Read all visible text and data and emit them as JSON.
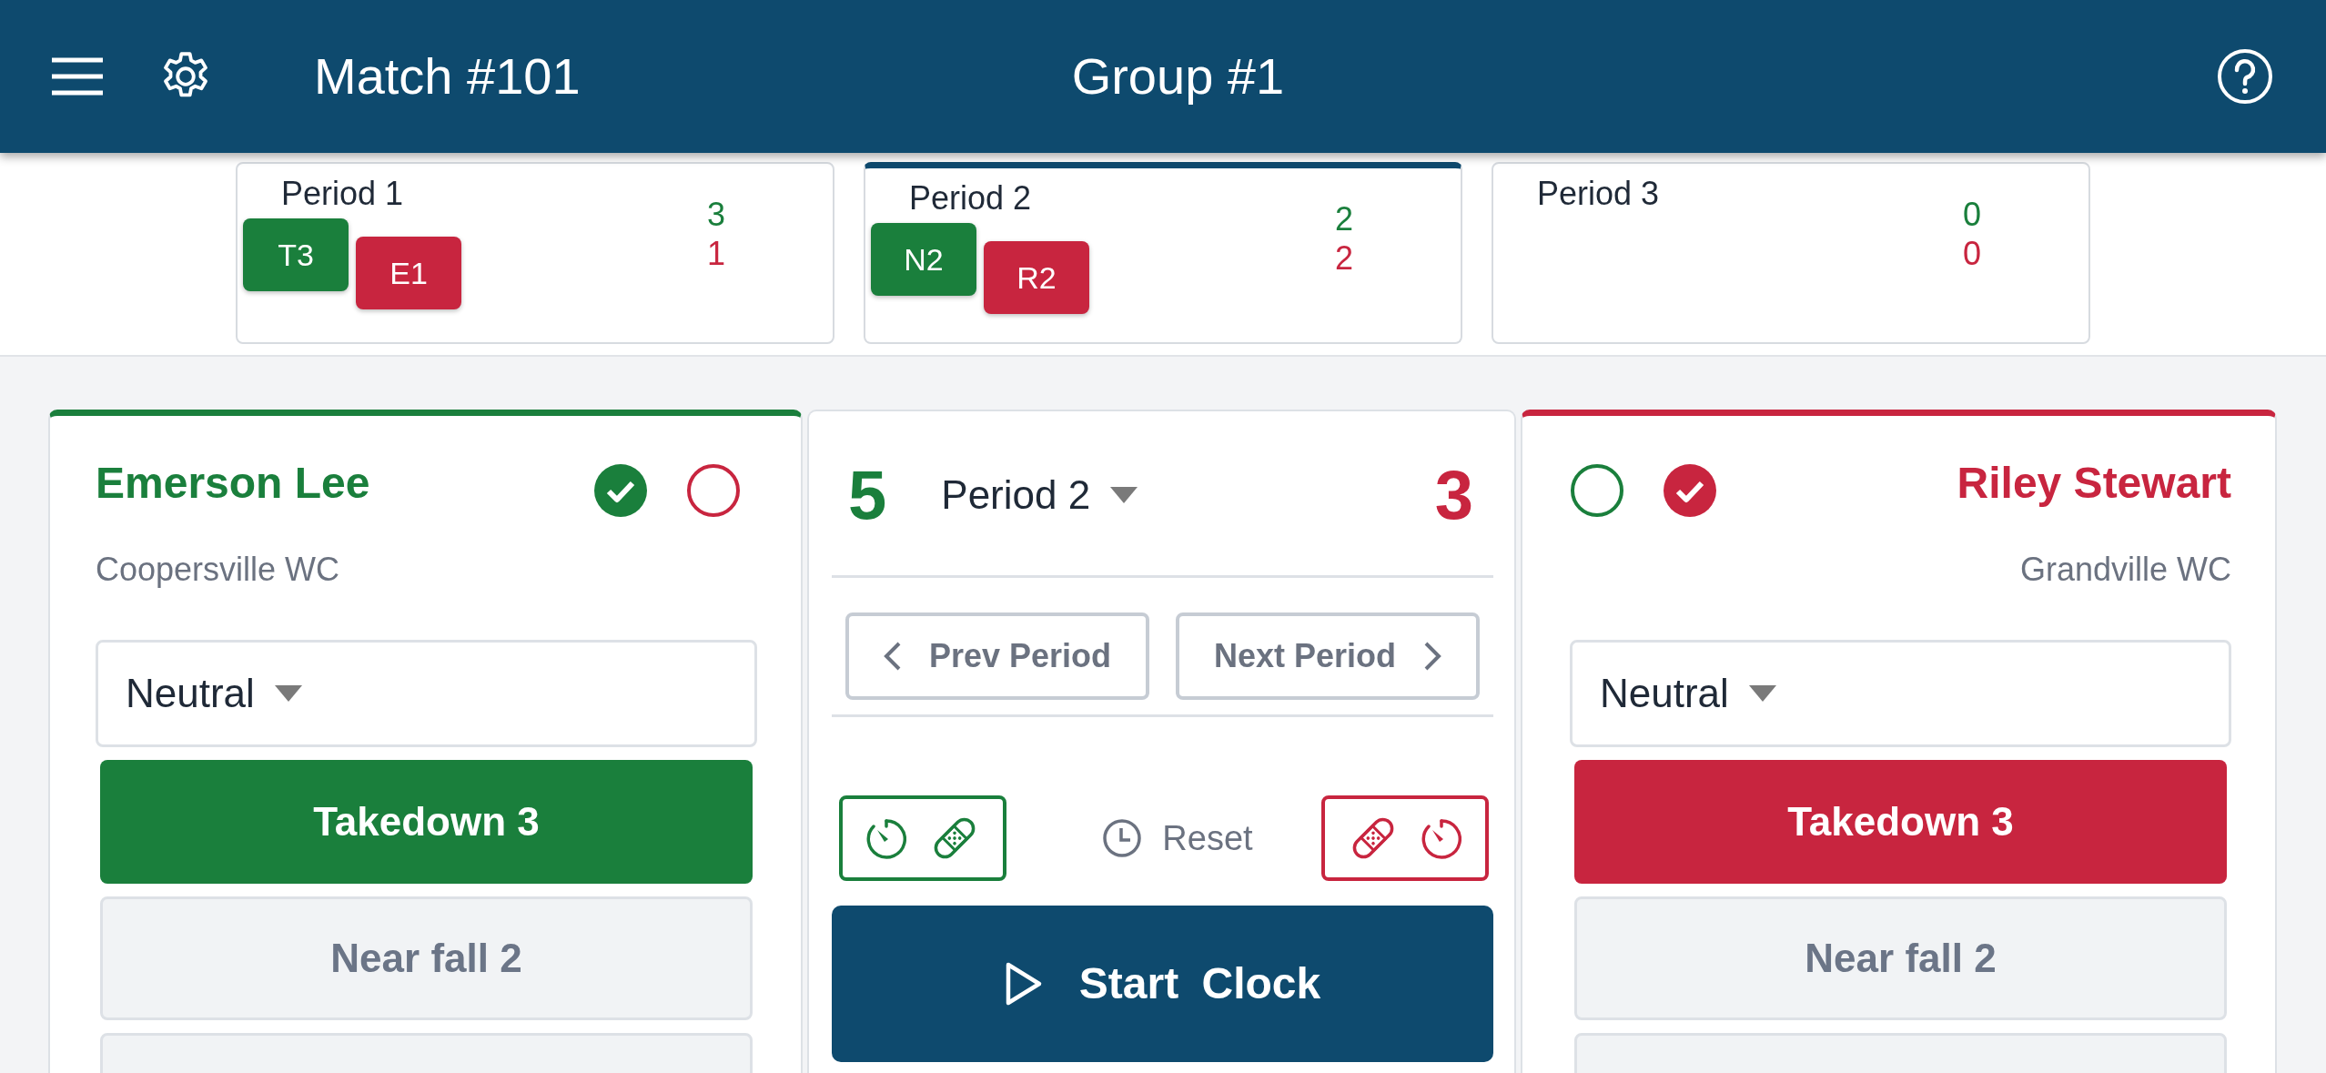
{
  "header": {
    "title": "Match #101",
    "subtitle": "Group #1"
  },
  "periods": [
    {
      "label": "Period 1",
      "selected": false,
      "chips": [
        {
          "text": "T3",
          "color": "#1a7f3c"
        },
        {
          "text": "E1",
          "color": "#c8253f"
        }
      ],
      "scores": [
        {
          "text": "3",
          "color": "#1a7f3c"
        },
        {
          "text": "1",
          "color": "#c8253f"
        }
      ]
    },
    {
      "label": "Period 2",
      "selected": true,
      "chips": [
        {
          "text": "N2",
          "color": "#1a7f3c"
        },
        {
          "text": "R2",
          "color": "#c8253f"
        }
      ],
      "scores": [
        {
          "text": "2",
          "color": "#1a7f3c"
        },
        {
          "text": "2",
          "color": "#c8253f"
        }
      ]
    },
    {
      "label": "Period 3",
      "selected": false,
      "scores": [
        {
          "text": "0",
          "color": "#1a7f3c"
        },
        {
          "text": "0",
          "color": "#c8253f"
        }
      ]
    }
  ],
  "wrestlers": [
    {
      "kind": "left",
      "name": "Emerson Lee",
      "team": "Coopersville WC",
      "color": "#1a7f3c",
      "marks": [
        {
          "color": "#1a7f3c",
          "checked": true
        },
        {
          "color": "#c8253f",
          "checked": false
        }
      ],
      "position": "Neutral",
      "actions": [
        {
          "kind": "primary",
          "label": "Takedown 3"
        },
        {
          "kind": "secondary",
          "label": "Near fall 2"
        },
        {
          "kind": "secondary"
        }
      ]
    },
    {
      "kind": "right",
      "name": "Riley Stewart",
      "team": "Grandville WC",
      "color": "#c8253f",
      "marks": [
        {
          "color": "#1a7f3c",
          "checked": false
        },
        {
          "color": "#c8253f",
          "checked": true
        }
      ],
      "position": "Neutral",
      "actions": [
        {
          "kind": "primary",
          "label": "Takedown 3"
        },
        {
          "kind": "secondary",
          "label": "Near fall 2"
        },
        {
          "kind": "secondary"
        }
      ]
    }
  ],
  "center": {
    "scores": [
      {
        "text": "5",
        "color": "#1a7f3c"
      },
      {
        "text": "3",
        "color": "#c8253f"
      }
    ],
    "period_select": "Period 2",
    "prev_button": "Prev Period",
    "next_button": "Next Period",
    "timer_boxes": [
      {
        "kind": "left",
        "color": "#1a7f3c"
      },
      {
        "kind": "right",
        "color": "#c8253f"
      }
    ],
    "reset": "Reset",
    "start_button": "Start Clock"
  }
}
